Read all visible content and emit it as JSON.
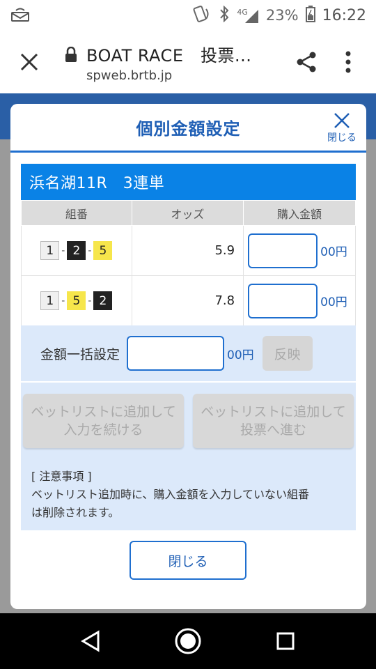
{
  "status_bar": {
    "network": "4G",
    "battery": "23%",
    "time": "16:22"
  },
  "browser": {
    "title": "BOAT RACE　投票...",
    "url": "spweb.brtb.jp"
  },
  "modal": {
    "title": "個別金額設定",
    "close_label": "閉じる",
    "race": "浜名湖11R　3連単",
    "table": {
      "headers": [
        "組番",
        "オッズ",
        "購入金額"
      ],
      "rows": [
        {
          "combo": [
            "1",
            "2",
            "5"
          ],
          "odds": "5.9",
          "amount": "",
          "unit": "00円"
        },
        {
          "combo": [
            "1",
            "5",
            "2"
          ],
          "odds": "7.8",
          "amount": "",
          "unit": "00円"
        }
      ]
    },
    "lump": {
      "label": "金額一括設定",
      "value": "",
      "unit": "00円",
      "reflect": "反映"
    },
    "actions": {
      "continue_line1": "ベットリストに追加して",
      "continue_line2": "入力を続ける",
      "proceed_line1": "ベットリストに追加して",
      "proceed_line2": "投票へ進む"
    },
    "notes": {
      "title": "[ 注意事項 ]",
      "line1": "ベットリスト追加時に、購入金額を入力していない組番",
      "line2": "は削除されます。"
    },
    "close_button": "閉じる"
  },
  "colors": {
    "accent": "#1f6fcf",
    "race_header": "#0a82e6",
    "panel_bg": "#dce9fa",
    "boat_1": "#f0f0f0",
    "boat_2": "#222222",
    "boat_5": "#f6e64b"
  }
}
